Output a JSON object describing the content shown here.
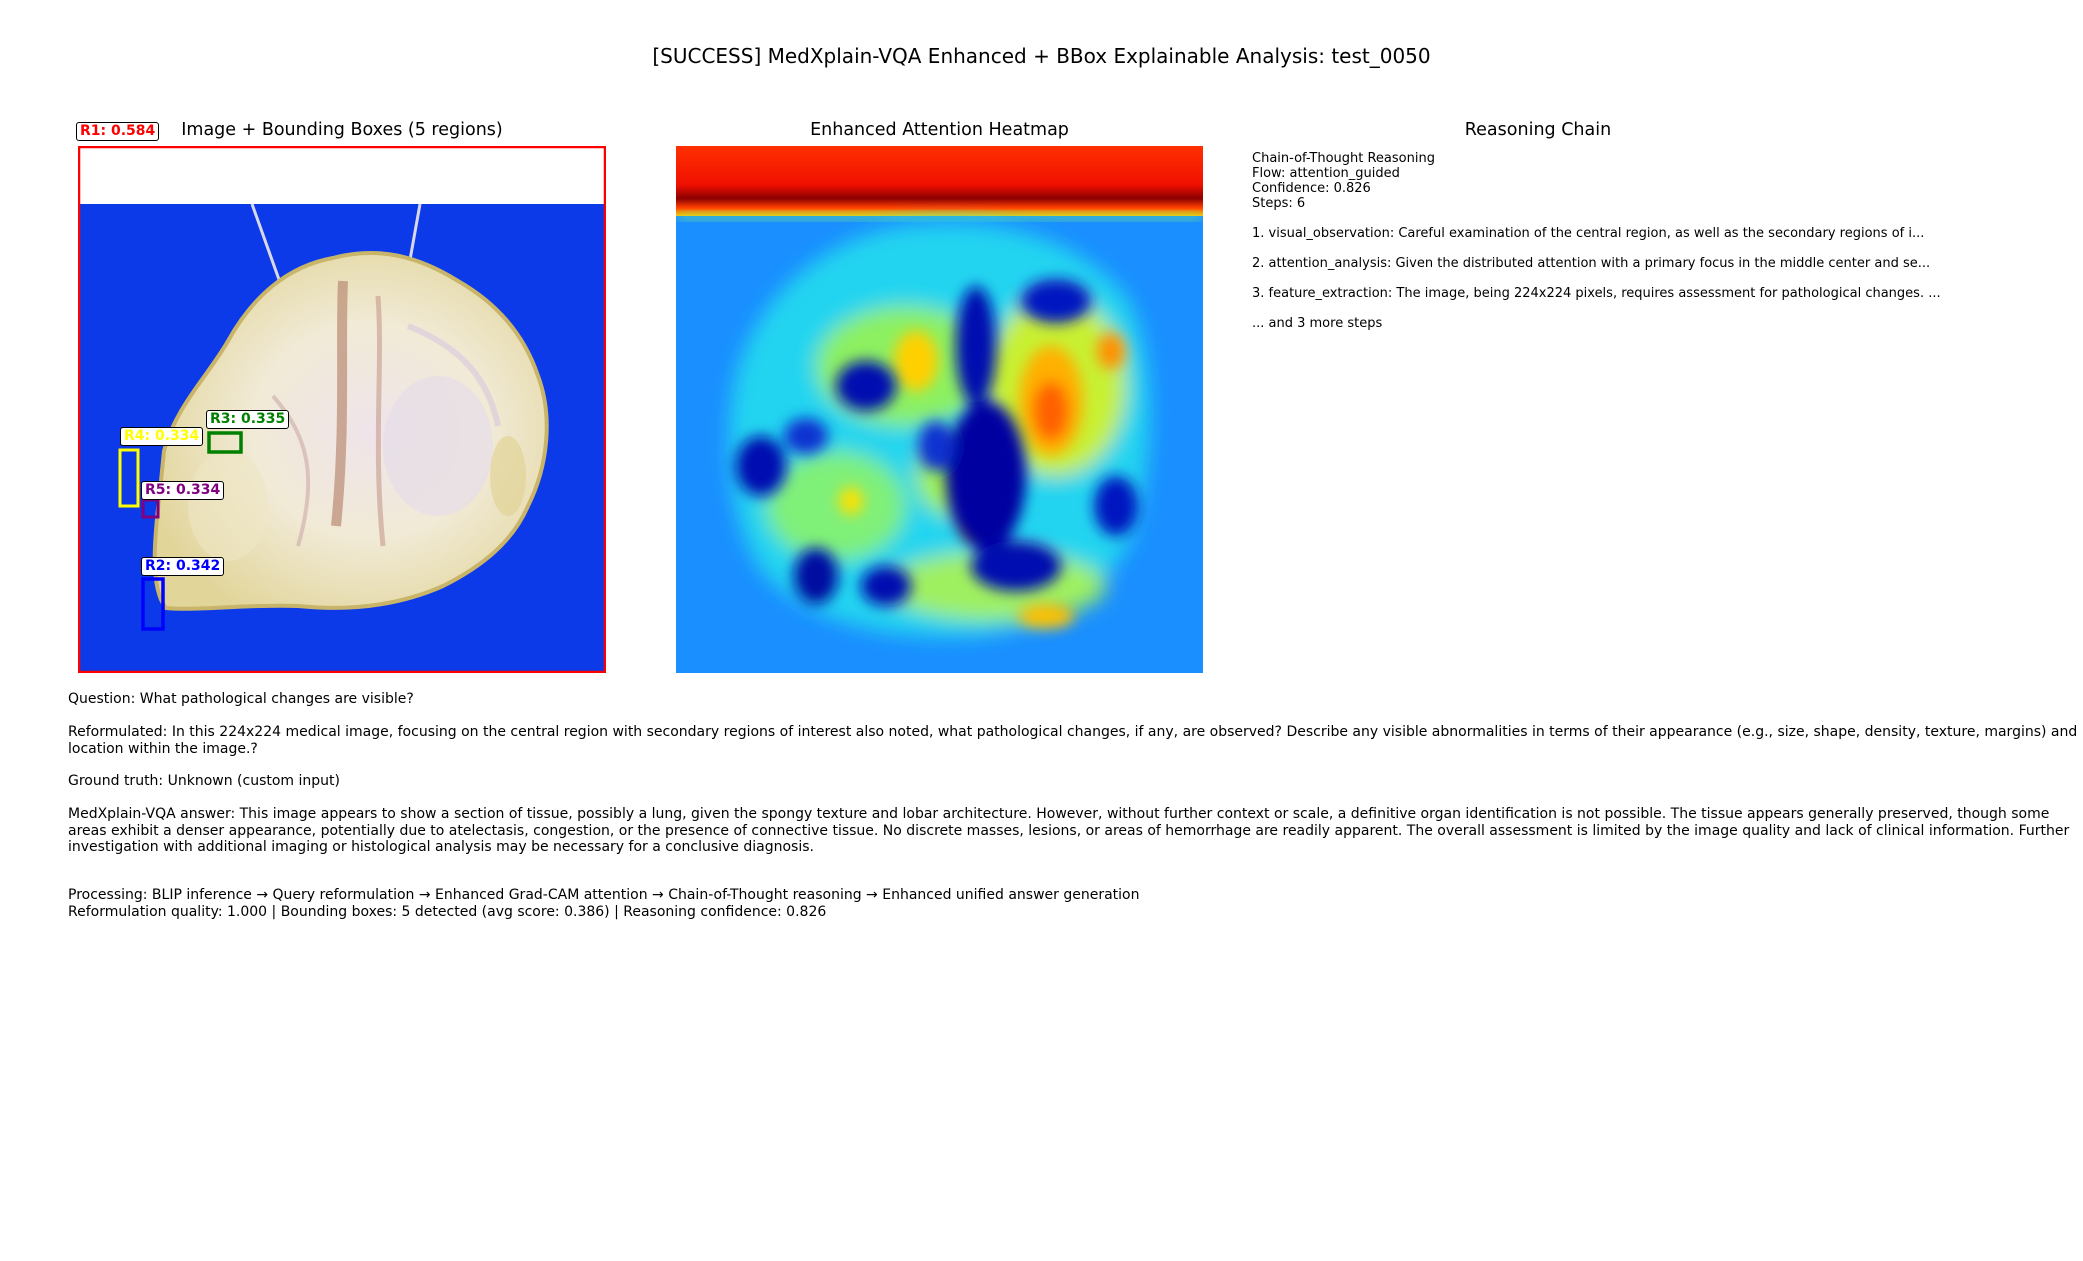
{
  "suptitle": "[SUCCESS] MedXplain-VQA Enhanced + BBox Explainable Analysis: test_0050",
  "panels": {
    "image": {
      "title": "Image + Bounding Boxes (5 regions)",
      "boxes": [
        {
          "label": "R1: 0.584",
          "color": "#ff0000"
        },
        {
          "label": "R2: 0.342",
          "color": "#0000ff"
        },
        {
          "label": "R3: 0.335",
          "color": "#008000"
        },
        {
          "label": "R4: 0.334",
          "color": "#ffff00"
        },
        {
          "label": "R5: 0.334",
          "color": "#800080"
        }
      ]
    },
    "heatmap": {
      "title": "Enhanced Attention Heatmap",
      "colormap": "jet"
    },
    "reasoning": {
      "title": "Reasoning Chain",
      "header": "Chain-of-Thought Reasoning",
      "flow": "Flow: attention_guided",
      "confidence": "Confidence: 0.826",
      "steps_count": "Steps: 6",
      "steps": [
        "1. visual_observation: Careful examination of the central region, as well as the secondary regions of i...",
        "2. attention_analysis: Given the distributed attention with a primary focus in the middle center and se...",
        "3. feature_extraction: The image, being 224x224 pixels, requires assessment for pathological changes.  ..."
      ],
      "more": "... and 3 more steps"
    }
  },
  "question": "Question: What pathological changes are visible?",
  "reformulated": "Reformulated: In this 224x224 medical image, focusing on the central region with secondary regions of interest also noted, what pathological changes, if any, are observed?  Describe any visible abnormalities in terms of their appearance (e.g., size, shape, density, texture, margins) and location within the image.?",
  "ground_truth": "Ground truth: Unknown (custom input)",
  "answer": "MedXplain-VQA answer: This image appears to show a section of tissue, possibly a lung, given the spongy texture and lobar architecture.  However, without further context or scale, a definitive organ identification is not possible.  The tissue appears generally preserved, though some areas exhibit a denser appearance, potentially due to atelectasis, congestion, or the presence of connective tissue.  No discrete masses, lesions, or areas of hemorrhage are readily apparent.  The overall assessment is limited by the image quality and lack of clinical information.  Further investigation with additional imaging or histological analysis may be necessary for a conclusive diagnosis.",
  "processing": "Processing: BLIP inference → Query reformulation → Enhanced Grad-CAM attention → Chain-of-Thought reasoning → Enhanced unified answer generation",
  "summary": "Reformulation quality: 1.000 | Bounding boxes: 5 detected (avg score: 0.386) | Reasoning confidence: 0.826"
}
